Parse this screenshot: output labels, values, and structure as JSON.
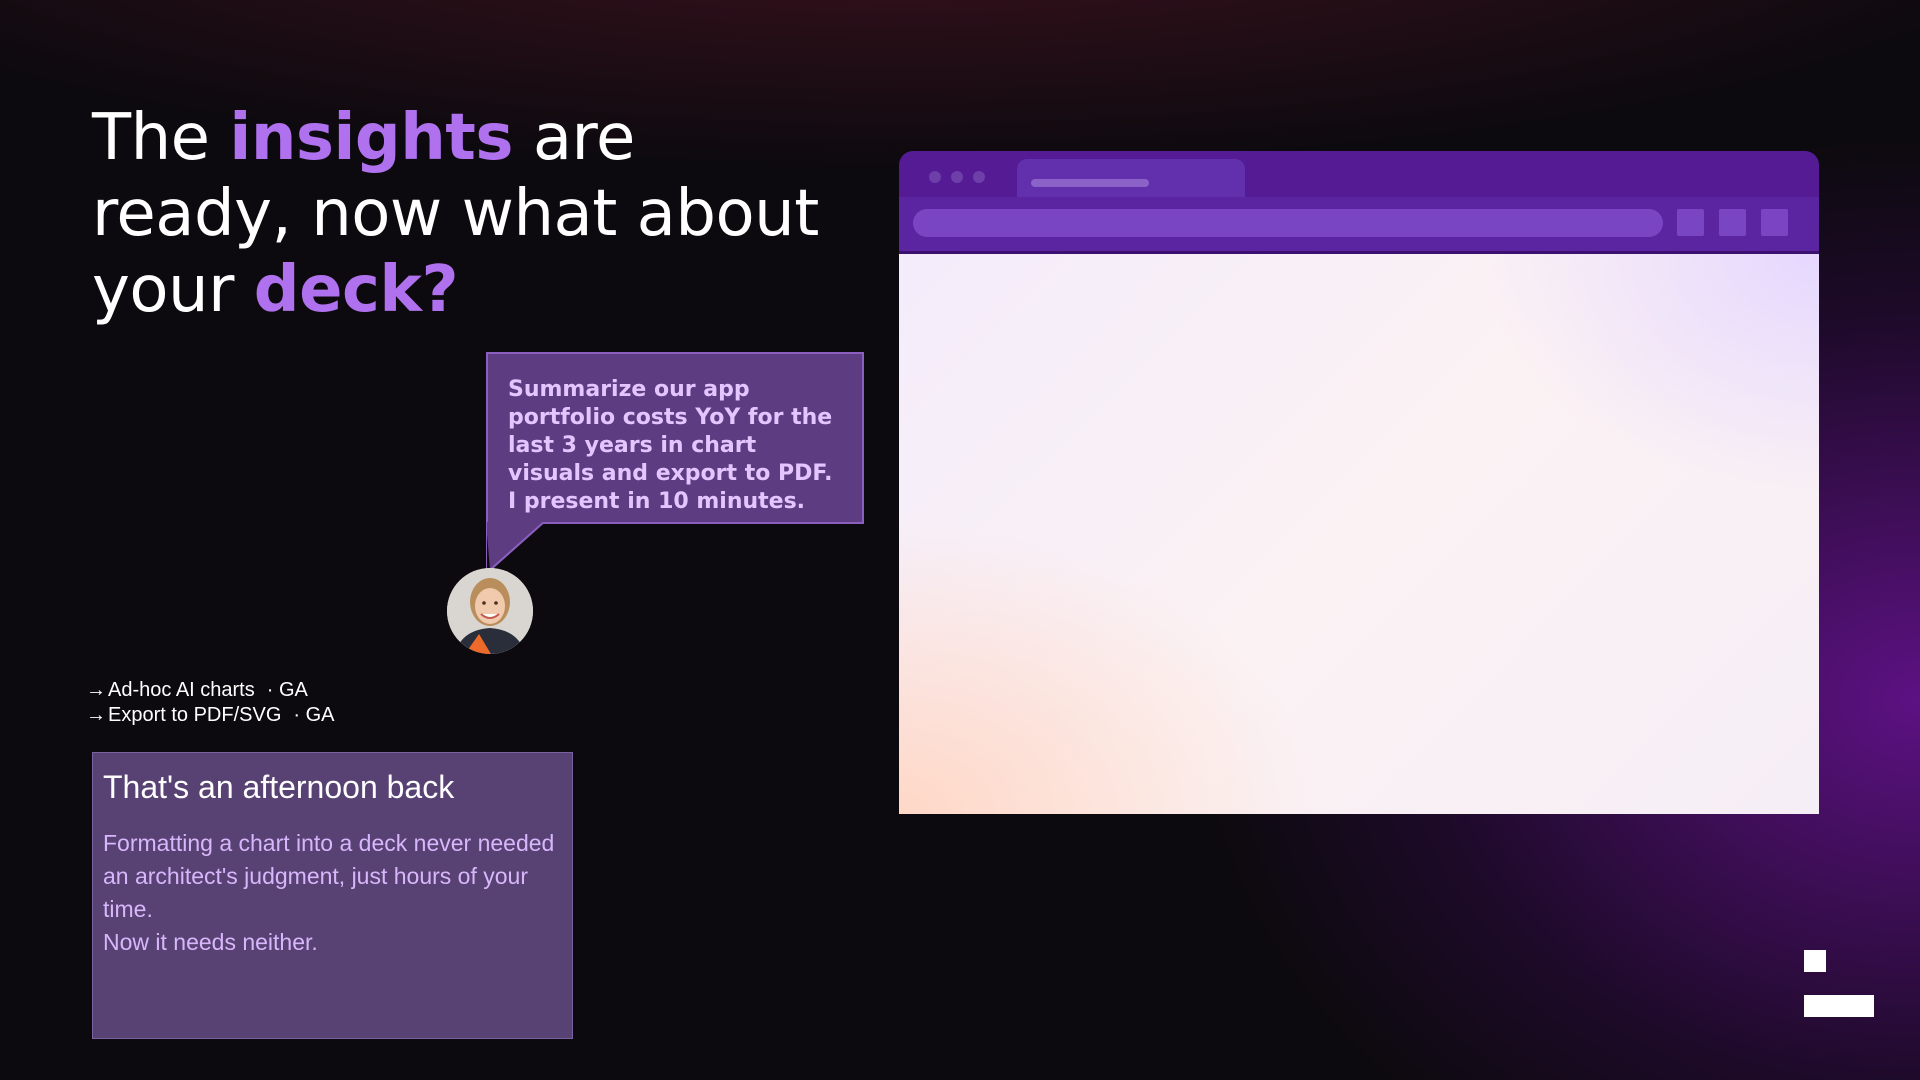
{
  "headline": {
    "part1": "The ",
    "accent1": "insights",
    "part2": " are ready, now what about your ",
    "accent2": "deck?"
  },
  "chat": {
    "message": "Summarize our app portfolio costs YoY for the last 3 years in chart visuals and export to PDF. I present in 10 minutes.",
    "avatar_icon": "user-avatar-photo"
  },
  "features": [
    {
      "icon": "arrow-right-icon",
      "label": "Ad-hoc AI charts",
      "tag": "· GA"
    },
    {
      "icon": "arrow-right-icon",
      "label": "Export to PDF/SVG",
      "tag": "· GA"
    }
  ],
  "card": {
    "title": "That's an afternoon back",
    "body_line1": "Formatting a chart into a deck never needed an architect's judgment, just hours of your time.",
    "body_line2": "Now it needs neither."
  },
  "colors": {
    "accent": "#b071ee",
    "bubble_bg": "#5d3c81",
    "bubble_text": "#e3c6ff",
    "card_bg": "#584273",
    "card_text": "#d8b6fb",
    "browser_chrome": "#541b94",
    "background": "#0d0a0f"
  },
  "logo": {
    "icon": "brand-logo-icon"
  }
}
